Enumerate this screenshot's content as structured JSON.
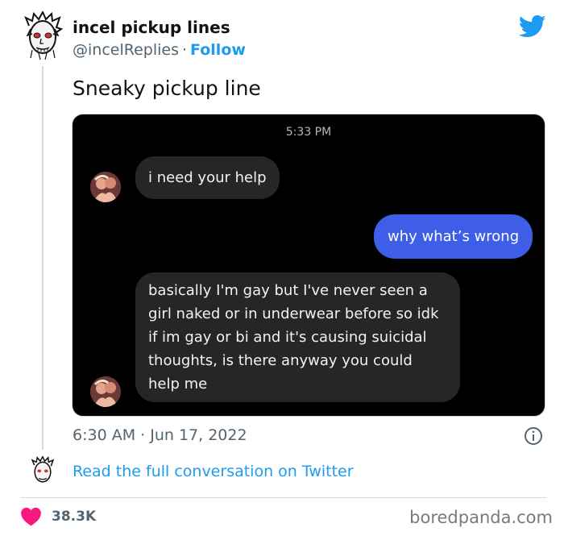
{
  "author": {
    "name": "incel pickup lines",
    "handle": "@incelReplies",
    "separator": "·",
    "follow_label": "Follow",
    "avatar_icon": "sketch-face-avatar-icon"
  },
  "tweet": {
    "text": "Sneaky pickup line",
    "timestamp": "6:30 AM · Jun 17, 2022",
    "read_more": "Read the full conversation on Twitter",
    "likes": "38.3K"
  },
  "chat": {
    "time": "5:33 PM",
    "messages": [
      {
        "side": "in",
        "text": "i need your help"
      },
      {
        "side": "out",
        "text": "why what’s wrong"
      },
      {
        "side": "in",
        "lines": [
          "basically I'm gay but I've never seen a",
          "girl naked or in underwear before so idk",
          "if im gay or bi and it's causing suicidal",
          "thoughts, is there anyway you could",
          "help me"
        ]
      }
    ]
  },
  "watermark": "boredpanda.com",
  "colors": {
    "twitter_blue": "#1d9bf0",
    "outgoing_bubble": "#3f5ee8",
    "incoming_bubble": "#262626",
    "heart": "#f91880"
  }
}
